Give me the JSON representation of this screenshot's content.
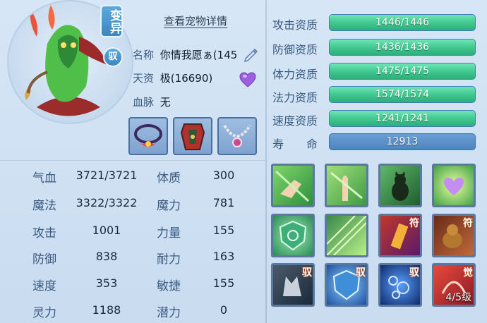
{
  "badges": {
    "mutation": "变异",
    "tame": "驭"
  },
  "detail_link": "查看宠物详情",
  "info": {
    "name_label": "名称",
    "name_value": "你情我愿ぁ(145",
    "aptitude_label": "天资",
    "aptitude_value": "极(16690)",
    "bloodline_label": "血脉",
    "bloodline_value": "无"
  },
  "stats_left": [
    {
      "label": "气血",
      "value": "3721/3721"
    },
    {
      "label": "魔法",
      "value": "3322/3322"
    },
    {
      "label": "攻击",
      "value": "1001"
    },
    {
      "label": "防御",
      "value": "838"
    },
    {
      "label": "速度",
      "value": "353"
    },
    {
      "label": "灵力",
      "value": "1188"
    }
  ],
  "stats_right": [
    {
      "label": "体质",
      "value": "300"
    },
    {
      "label": "魔力",
      "value": "781"
    },
    {
      "label": "力量",
      "value": "155"
    },
    {
      "label": "耐力",
      "value": "163"
    },
    {
      "label": "敏捷",
      "value": "155"
    },
    {
      "label": "潜力",
      "value": "0"
    }
  ],
  "qualities": [
    {
      "label": "攻击资质",
      "value": "1446/1446",
      "fill": 1.0
    },
    {
      "label": "防御资质",
      "value": "1436/1436",
      "fill": 1.0
    },
    {
      "label": "体力资质",
      "value": "1475/1475",
      "fill": 1.0
    },
    {
      "label": "法力资质",
      "value": "1574/1574",
      "fill": 1.0
    },
    {
      "label": "速度资质",
      "value": "1241/1241",
      "fill": 1.0
    }
  ],
  "life": {
    "label": "寿　　命",
    "value": "12913"
  },
  "skills": [
    {
      "name": "hand-point-skill-icon",
      "tag": "",
      "level": ""
    },
    {
      "name": "palm-skill-icon",
      "tag": "",
      "level": ""
    },
    {
      "name": "black-cat-skill-icon",
      "tag": "",
      "level": ""
    },
    {
      "name": "heart-burst-skill-icon",
      "tag": "",
      "level": ""
    },
    {
      "name": "shield-swirl-skill-icon",
      "tag": "",
      "level": ""
    },
    {
      "name": "green-rays-skill-icon",
      "tag": "",
      "level": ""
    },
    {
      "name": "talisman-skill-icon",
      "tag": "符",
      "level": ""
    },
    {
      "name": "beast-skill-icon",
      "tag": "符",
      "level": ""
    },
    {
      "name": "wolf-skill-icon",
      "tag": "驭",
      "level": ""
    },
    {
      "name": "blue-shield-skill-icon",
      "tag": "驭",
      "level": ""
    },
    {
      "name": "bubbles-skill-icon",
      "tag": "驭",
      "level": ""
    },
    {
      "name": "awaken-skill-icon",
      "tag": "觉",
      "level": "4/5级"
    }
  ],
  "colors": {
    "accent": "#3c86c2",
    "bar_green": "#3fc58e",
    "heart": "#9d5fe0"
  }
}
